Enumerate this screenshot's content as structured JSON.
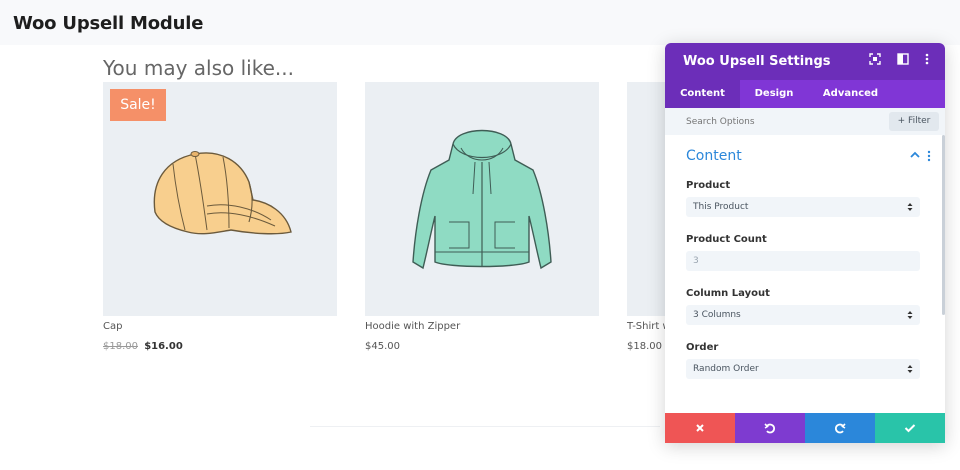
{
  "page": {
    "title": "Woo Upsell Module"
  },
  "upsell": {
    "heading": "You may also like...",
    "products": [
      {
        "name": "Cap",
        "old_price": "$18.00",
        "price": "$16.00",
        "sale": true,
        "sale_label": "Sale!",
        "image_icon": "cap-icon",
        "image_color": "#f8cf8e"
      },
      {
        "name": "Hoodie with Zipper",
        "price": "$45.00",
        "sale": false,
        "image_icon": "hoodie-icon",
        "image_color": "#8fdbc3"
      },
      {
        "name": "T-Shirt w",
        "price": "$18.00",
        "sale": false,
        "image_icon": "tshirt-icon"
      }
    ]
  },
  "panel": {
    "title": "Woo Upsell Settings",
    "header_icons": [
      "fullscreen-icon",
      "columns-icon",
      "more-icon"
    ],
    "tabs": [
      {
        "label": "Content",
        "active": true
      },
      {
        "label": "Design",
        "active": false
      },
      {
        "label": "Advanced",
        "active": false
      }
    ],
    "search": {
      "placeholder": "Search Options"
    },
    "filter_label": "+ Filter",
    "group": {
      "title": "Content",
      "fields": [
        {
          "label": "Product",
          "value": "This Product",
          "type": "select"
        },
        {
          "label": "Product Count",
          "value": "3",
          "type": "input"
        },
        {
          "label": "Column Layout",
          "value": "3 Columns",
          "type": "select"
        },
        {
          "label": "Order",
          "value": "Random Order",
          "type": "select"
        }
      ]
    },
    "footer_buttons": [
      {
        "name": "discard",
        "icon": "close-icon",
        "color": "#ef5555"
      },
      {
        "name": "undo",
        "icon": "undo-icon",
        "color": "#7e3bd0"
      },
      {
        "name": "redo",
        "icon": "redo-icon",
        "color": "#2b87da"
      },
      {
        "name": "save",
        "icon": "check-icon",
        "color": "#29c4a9"
      }
    ],
    "colors": {
      "header": "#6c2eb9",
      "tabs": "#8036d6",
      "accent": "#2b87da"
    }
  }
}
